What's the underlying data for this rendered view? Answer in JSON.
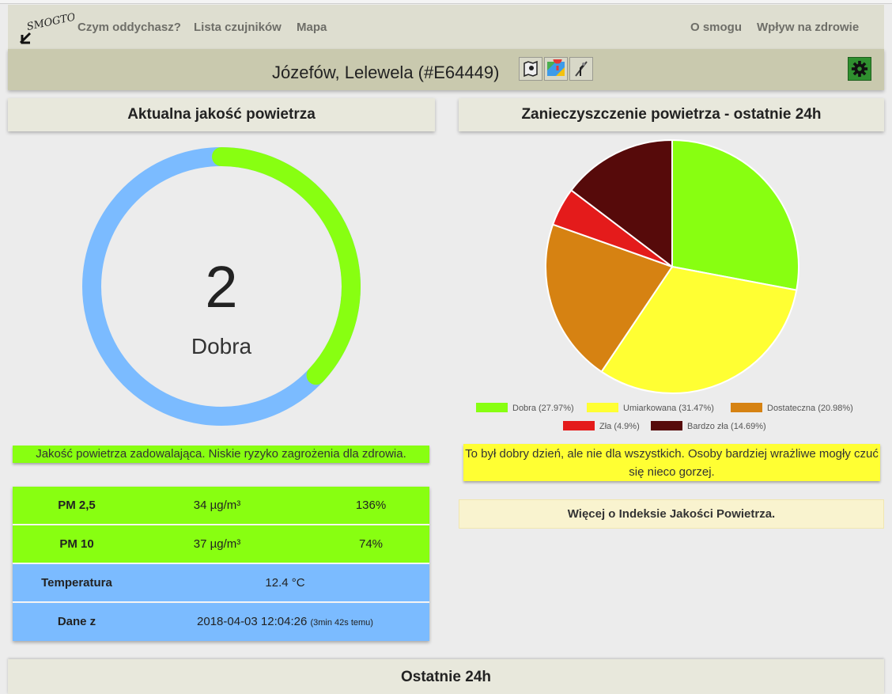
{
  "nav": {
    "logo_text": "SMOGTOK",
    "items_left": [
      "Czym oddychasz?",
      "Lista czujników",
      "Mapa"
    ],
    "items_right": [
      "O smogu",
      "Wpływ na zdrowie"
    ]
  },
  "station": {
    "title": "Józefów, Lelewela (#E64449)",
    "icons": [
      "map-marker-icon",
      "google-maps-icon",
      "compass-icon"
    ],
    "settings_icon": "gear-icon"
  },
  "left_panel": {
    "header": "Aktualna jakość powietrza",
    "gauge": {
      "value": "2",
      "label": "Dobra",
      "fill_fraction": 0.37,
      "track_color": "#7bbbff",
      "fill_color": "#88ff11"
    },
    "status": "Jakość powietrza zadowalająca. Niskie ryzyko zagrożenia dla zdrowia.",
    "table": [
      {
        "label": "PM 2,5",
        "value": "34 µg/m³",
        "percent": "136%",
        "color": "#88ff11"
      },
      {
        "label": "PM 10",
        "value": "37 µg/m³",
        "percent": "74%",
        "color": "#88ff11"
      },
      {
        "label": "Temperatura",
        "value": "12.4 °C",
        "color": "#7bbbff"
      },
      {
        "label": "Dane z",
        "value": "2018-04-03 12:04:26",
        "ago": "(3min 42s temu)",
        "color": "#7bbbff"
      }
    ]
  },
  "right_panel": {
    "header": "Zanieczyszczenie powietrza - ostatnie 24h",
    "info": "To był dobry dzień, ale nie dla wszystkich. Osoby bardziej wrażliwe mogły czuć się nieco gorzej.",
    "more_link": "Więcej o Indeksie Jakości Powietrza."
  },
  "chart_data": {
    "type": "pie",
    "title": "",
    "legend_position": "bottom",
    "categories": [
      "Dobra",
      "Umiarkowana",
      "Dostateczna",
      "Zła",
      "Bardzo zła"
    ],
    "values": [
      27.97,
      31.47,
      20.98,
      4.9,
      14.69
    ],
    "colors": [
      "#88ff11",
      "#ffff33",
      "#d68212",
      "#e41b1b",
      "#560a0a"
    ],
    "legend_labels": [
      "Dobra (27.97%)",
      "Umiarkowana (31.47%)",
      "Dostateczna (20.98%)",
      "Zła (4.9%)",
      "Bardzo zła (14.69%)"
    ]
  },
  "bottom": {
    "header": "Ostatnie 24h"
  }
}
